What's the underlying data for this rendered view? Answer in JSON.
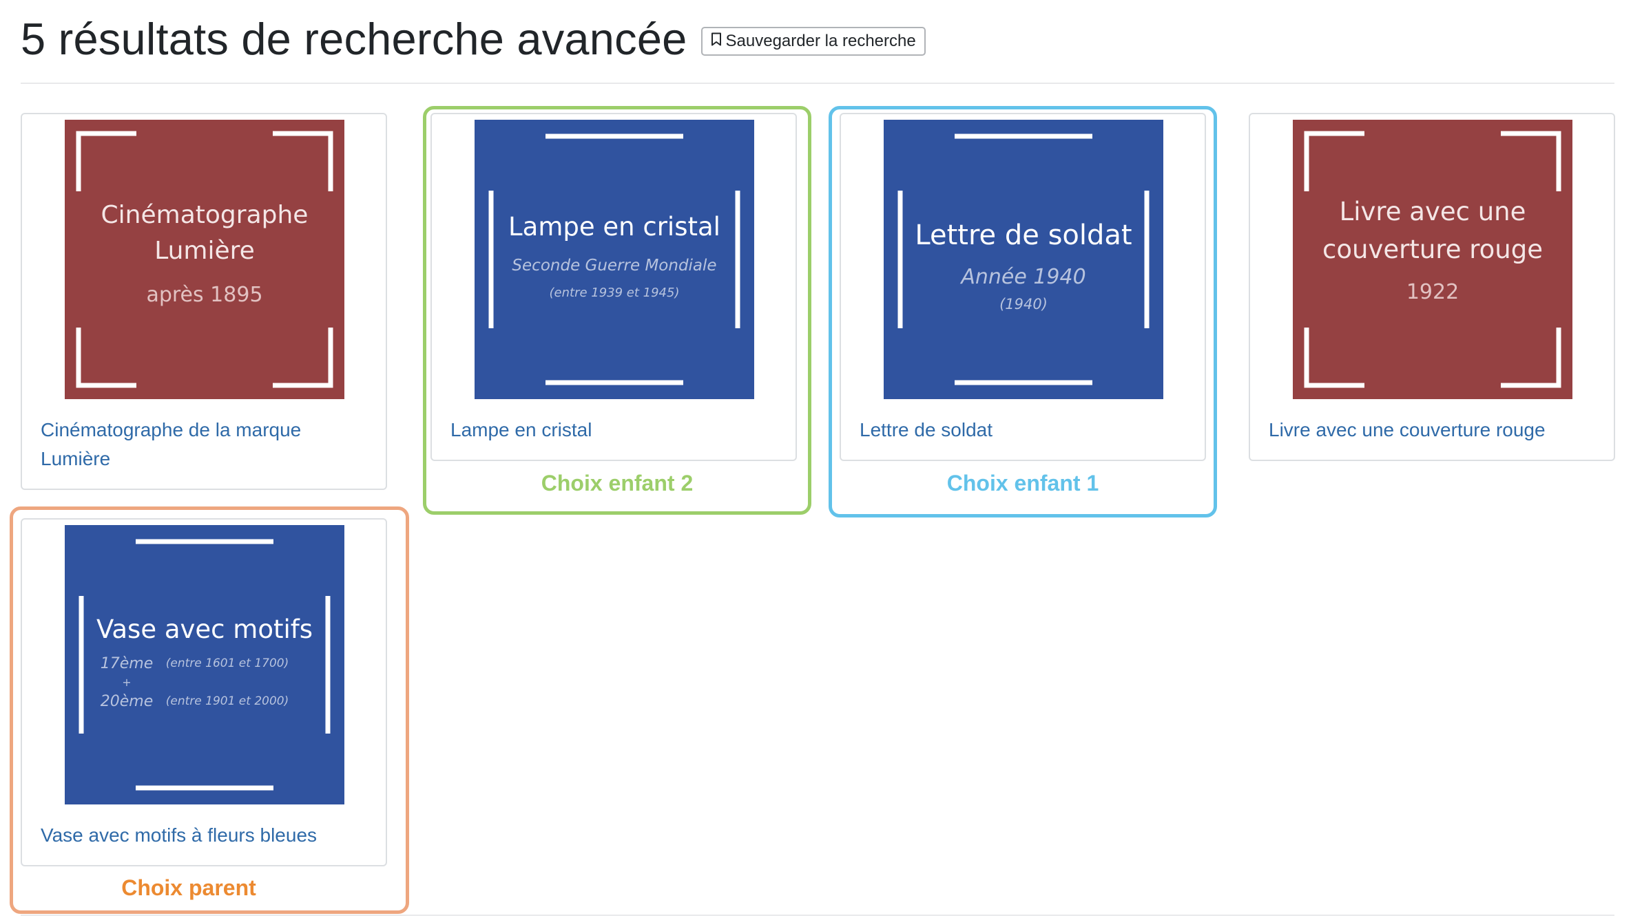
{
  "header": {
    "title": "5 résultats de recherche avancée",
    "save_label": "Sauvegarder la recherche"
  },
  "results": [
    {
      "thumb": {
        "bg": "#954142",
        "line1": "Cinématographe",
        "line2": "Lumière",
        "sub": "après 1895"
      },
      "link": "Cinématographe de la marque Lumière"
    },
    {
      "thumb": {
        "bg": "#30539f",
        "line1": "Lampe en cristal",
        "sub": "Seconde Guerre Mondiale",
        "sub2": "(entre 1939 et 1945)"
      },
      "link": "Lampe en cristal"
    },
    {
      "thumb": {
        "bg": "#30539f",
        "line1": "Lettre de soldat",
        "sub": "Année 1940",
        "sub2": "(1940)"
      },
      "link": "Lettre de soldat"
    },
    {
      "thumb": {
        "bg": "#954142",
        "line1": "Livre avec une",
        "line2": "couverture rouge",
        "sub": "1922"
      },
      "link": "Livre avec une couverture rouge"
    },
    {
      "thumb": {
        "bg": "#30539f",
        "line1": "Vase avec motifs",
        "a1": "17ème",
        "a1n": "(entre 1601 et 1700)",
        "plus": "+",
        "a2": "20ème",
        "a2n": "(entre 1901 et 2000)"
      },
      "link": "Vase avec motifs à fleurs bleues"
    }
  ],
  "highlights": [
    {
      "label": "Choix enfant 2",
      "color": "#9cce6a"
    },
    {
      "label": "Choix enfant 1",
      "color": "#62c2ea"
    },
    {
      "label": "Choix parent",
      "color": "#eea67f",
      "text_color": "#ec8a31"
    }
  ]
}
